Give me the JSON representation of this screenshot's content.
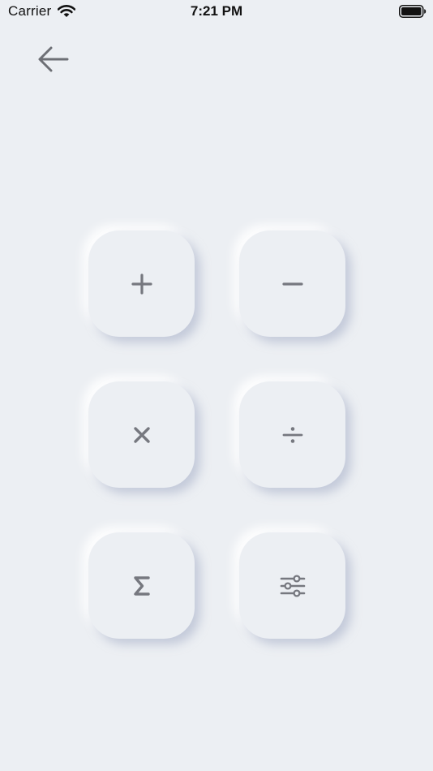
{
  "status_bar": {
    "carrier": "Carrier",
    "time": "7:21 PM",
    "wifi_icon": "wifi-icon",
    "battery_icon": "battery-full-icon"
  },
  "nav": {
    "back_icon": "arrow-left-icon"
  },
  "keys": [
    {
      "name": "add",
      "icon": "plus-icon"
    },
    {
      "name": "subtract",
      "icon": "minus-icon"
    },
    {
      "name": "multiply",
      "icon": "multiply-icon"
    },
    {
      "name": "divide",
      "icon": "divide-icon"
    },
    {
      "name": "sum",
      "icon": "sigma-icon"
    },
    {
      "name": "settings",
      "icon": "sliders-icon"
    }
  ],
  "colors": {
    "background": "#ECEFF3",
    "icon": "#76787F",
    "text": "#111111"
  }
}
